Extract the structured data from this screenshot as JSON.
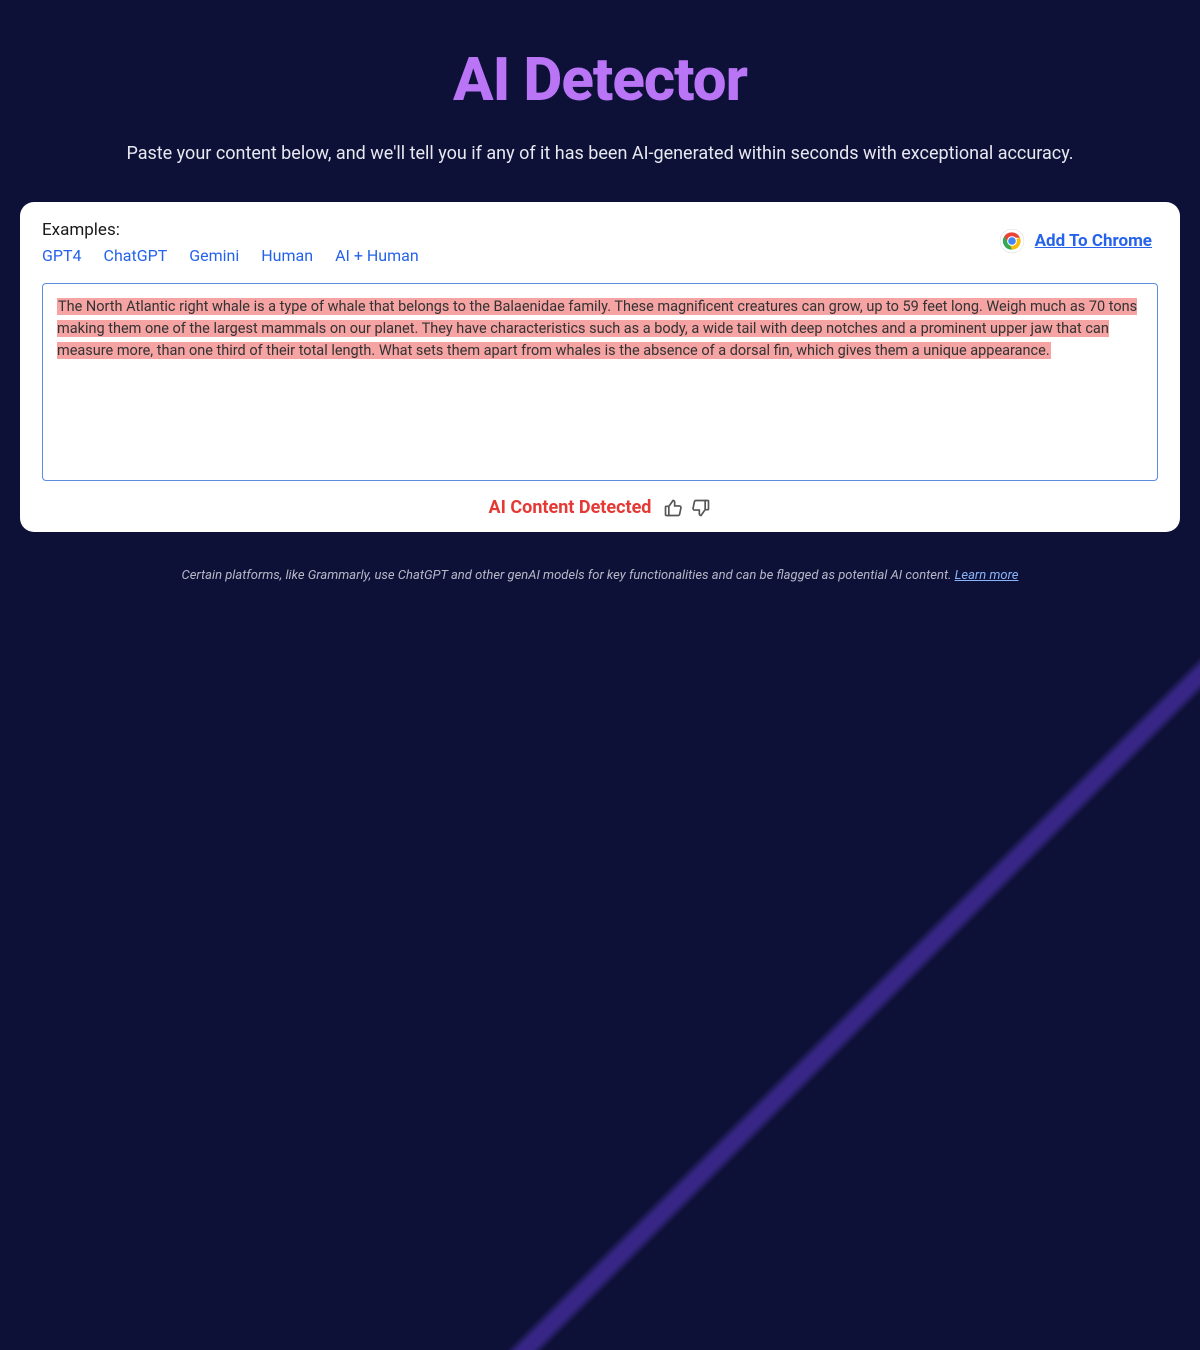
{
  "title": "AI Detector",
  "subtitle": "Paste your content below, and we'll tell you if any of it has been AI-generated within seconds with exceptional accuracy.",
  "examples": {
    "label": "Examples:",
    "items": [
      "GPT4",
      "ChatGPT",
      "Gemini",
      "Human",
      "AI + Human"
    ]
  },
  "chrome_cta": "Add To Chrome",
  "content_text": "The North Atlantic right whale is a type of whale that belongs to the Balaenidae family. These magnificent creatures can grow, up to 59 feet long. Weigh much as 70 tons making them one of the largest mammals on our planet. They have characteristics such as a body, a wide tail with deep notches and a prominent upper jaw that can measure more, than one third of their total length. What sets them apart from whales is the absence of a dorsal fin, which gives them a unique appearance.",
  "result": "AI Content Detected",
  "footer": {
    "text": "Certain platforms, like Grammarly, use ChatGPT and other genAI models for key functionalities and can be flagged as potential AI content. ",
    "link": "Learn more"
  }
}
